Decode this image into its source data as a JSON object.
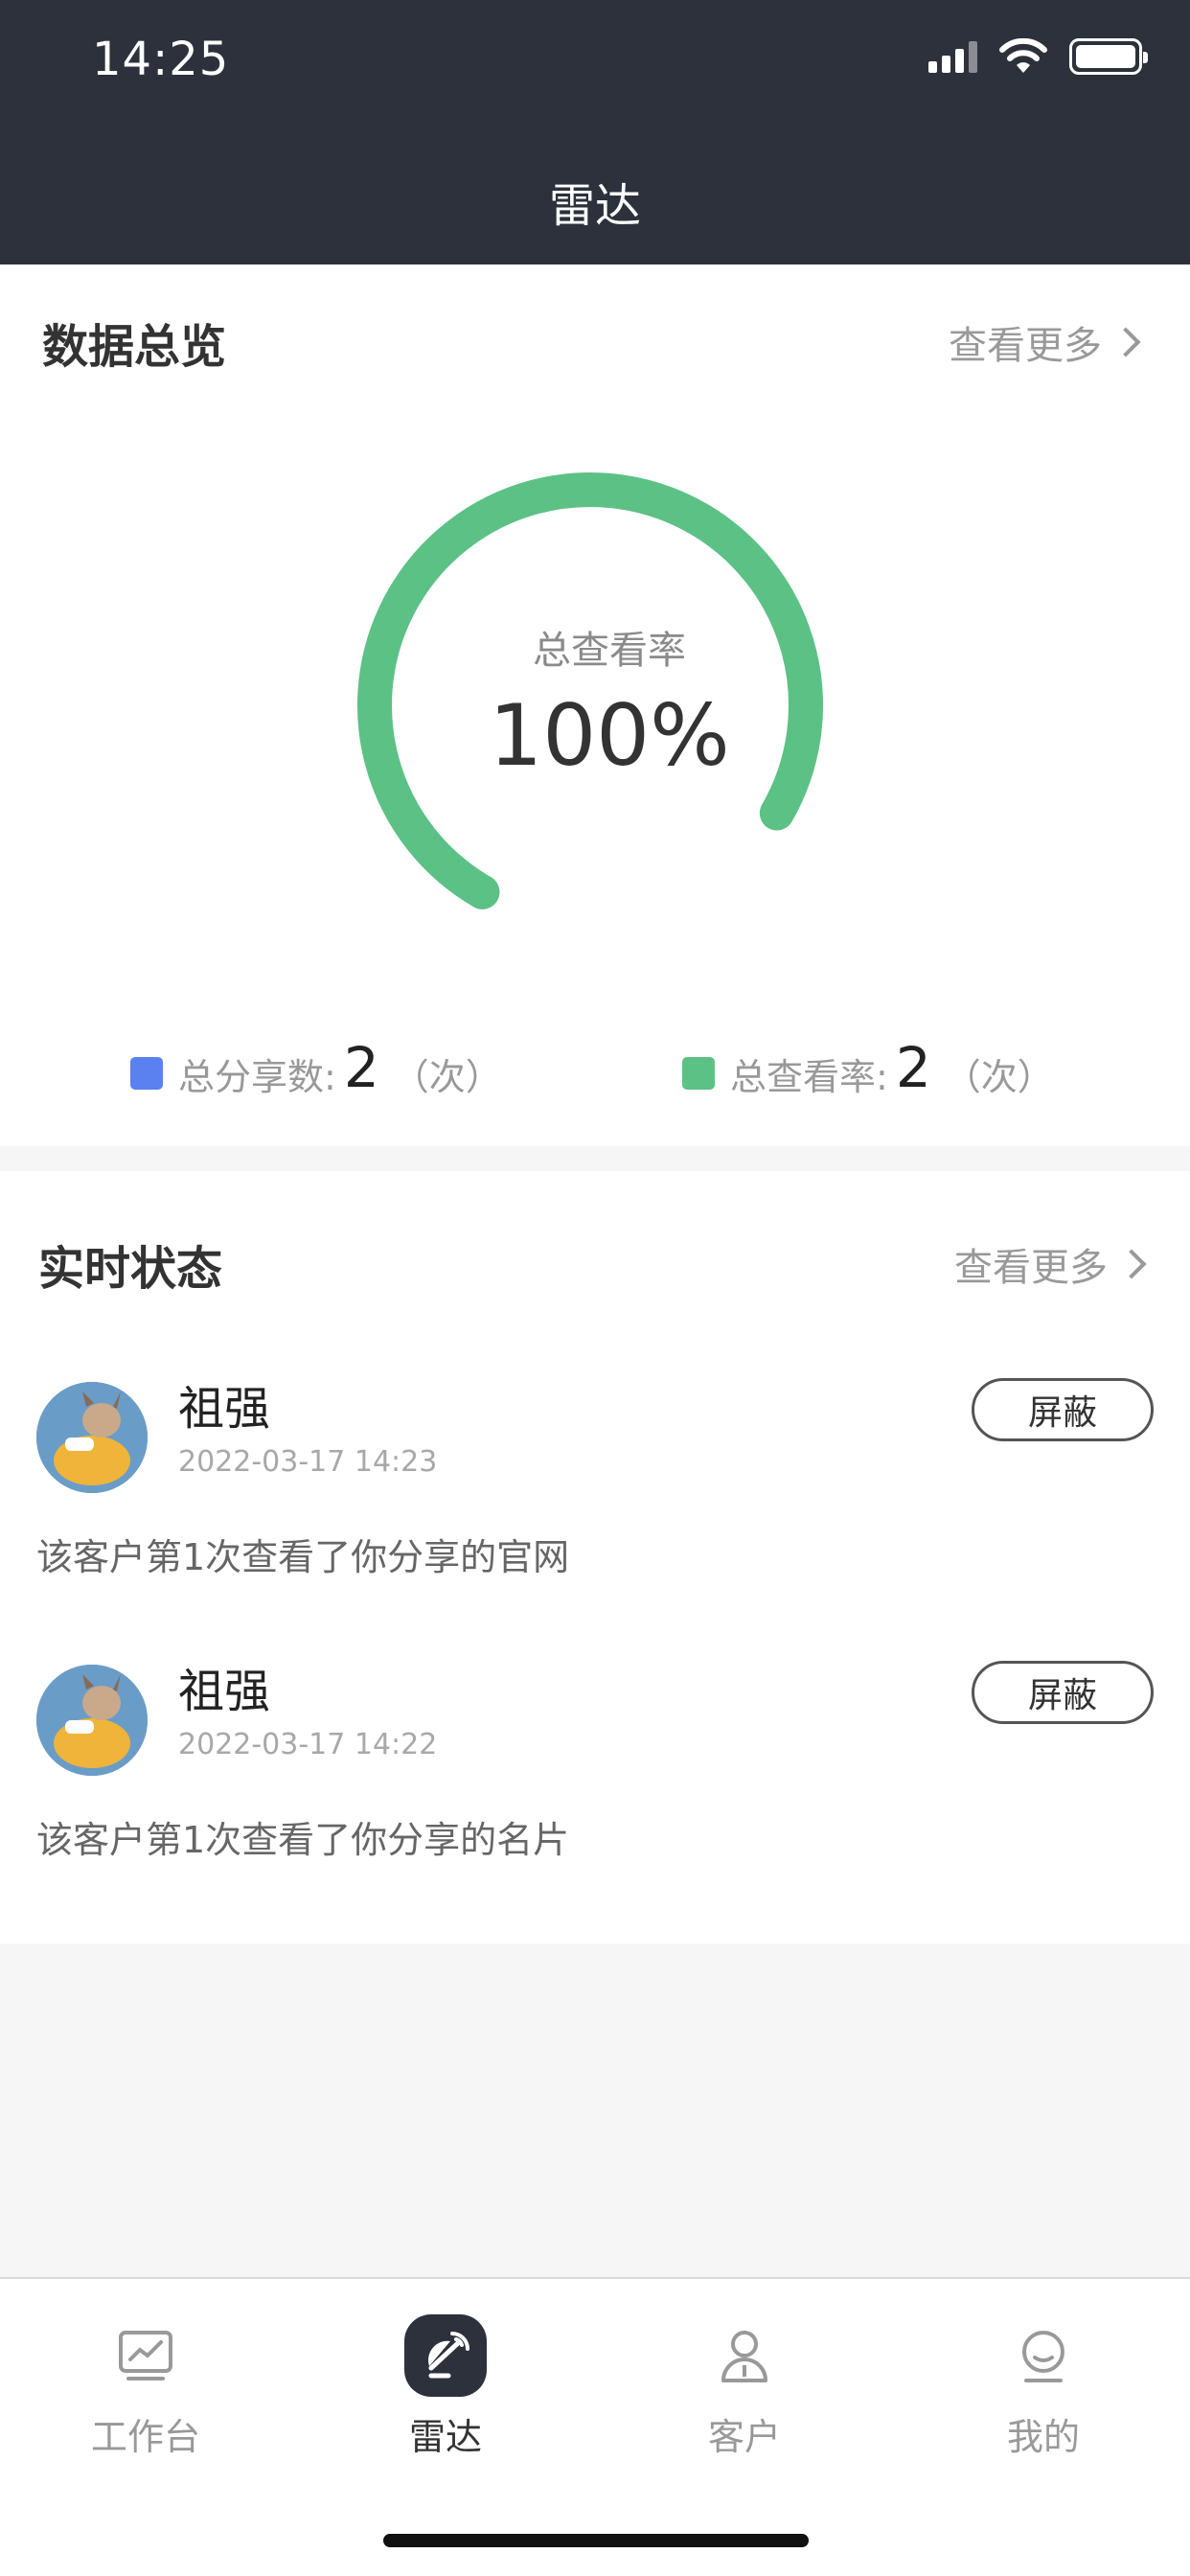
{
  "status_bar": {
    "time": "14:25"
  },
  "nav": {
    "title": "雷达"
  },
  "overview": {
    "title": "数据总览",
    "more_label": "查看更多",
    "gauge_label": "总查看率",
    "gauge_value": "100%",
    "view_rate_percent": 100,
    "legend": [
      {
        "label": "总分享数:",
        "value": "2",
        "unit": "（次）",
        "color": "#5b80f0"
      },
      {
        "label": "总查看率:",
        "value": "2",
        "unit": "（次）",
        "color": "#5cc185"
      }
    ]
  },
  "realtime": {
    "title": "实时状态",
    "more_label": "查看更多",
    "items": [
      {
        "name": "祖强",
        "time": "2022-03-17 14:23",
        "action": "屏蔽",
        "description": "该客户第1次查看了你分享的官网"
      },
      {
        "name": "祖强",
        "time": "2022-03-17 14:22",
        "action": "屏蔽",
        "description": "该客户第1次查看了你分享的名片"
      }
    ]
  },
  "tabs": [
    {
      "label": "工作台",
      "icon": "chart-monitor-icon",
      "active": false
    },
    {
      "label": "雷达",
      "icon": "radar-icon",
      "active": true
    },
    {
      "label": "客户",
      "icon": "person-icon",
      "active": false
    },
    {
      "label": "我的",
      "icon": "smile-face-icon",
      "active": false
    }
  ],
  "colors": {
    "header_bg": "#2c313b",
    "accent_green": "#5cc185",
    "accent_blue": "#5b80f0"
  }
}
